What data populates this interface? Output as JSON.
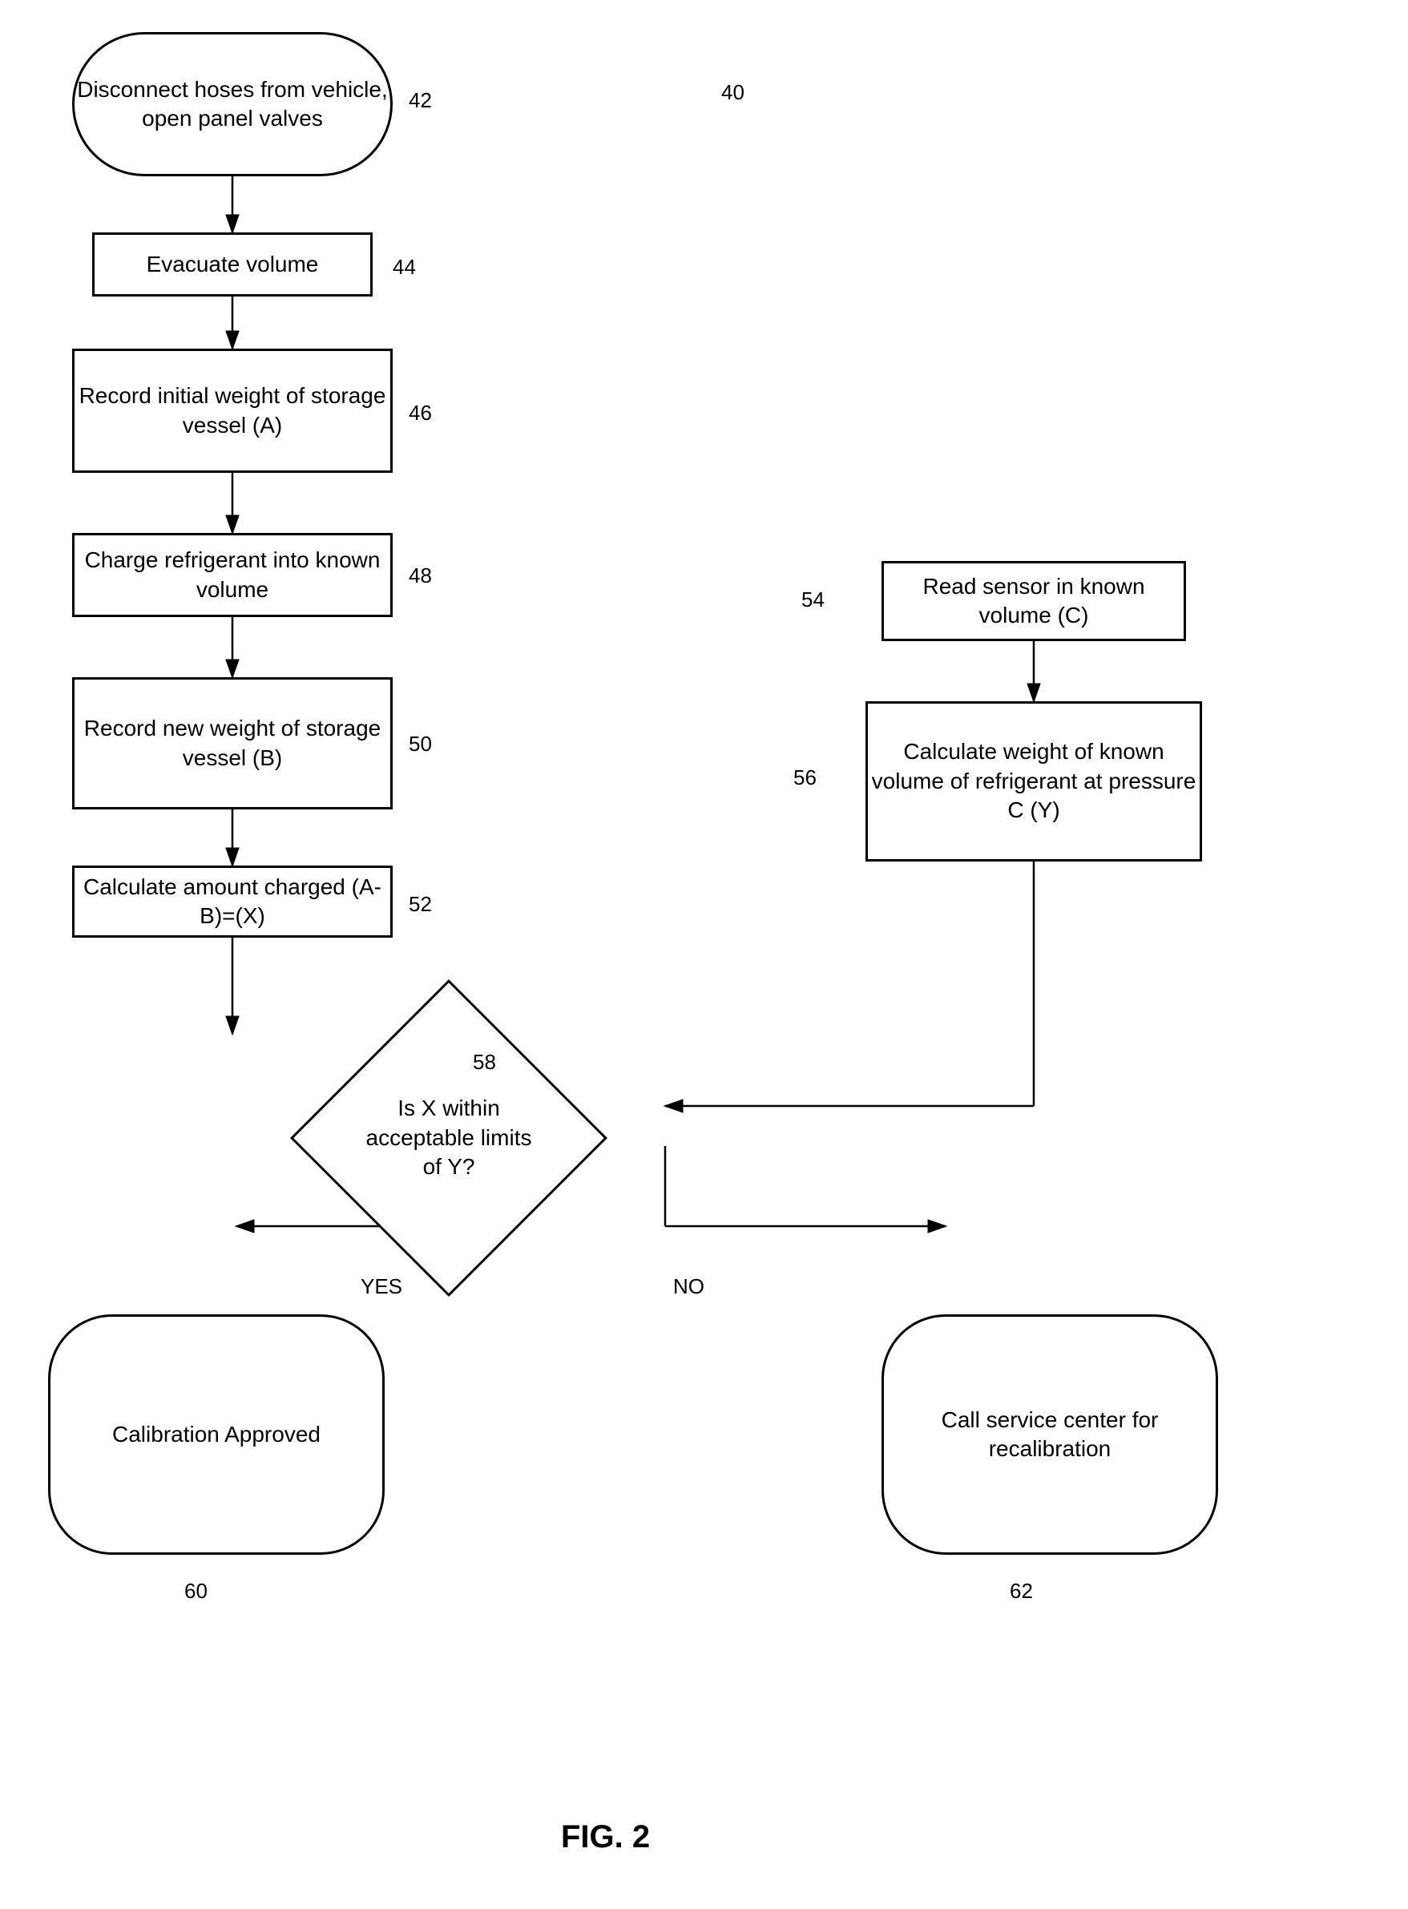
{
  "diagram": {
    "title": "FIG. 2",
    "figure_number": "40",
    "nodes": {
      "step42": {
        "label": "Disconnect\nhoses from\nvehicle, open\npanel valves",
        "id_label": "42"
      },
      "step44": {
        "label": "Evacuate volume",
        "id_label": "44"
      },
      "step46": {
        "label": "Record initial\nweight of storage\nvessel (A)",
        "id_label": "46"
      },
      "step48": {
        "label": "Charge refrigerant\ninto known volume",
        "id_label": "48"
      },
      "step50": {
        "label": "Record new\nweight of storage\nvessel (B)",
        "id_label": "50"
      },
      "step52": {
        "label": "Calculate amount\ncharged (A-B)=(X)",
        "id_label": "52"
      },
      "step54": {
        "label": "Read sensor in\nknown volume (C)",
        "id_label": "54"
      },
      "step56": {
        "label": "Calculate weight of\nknown volume of\nrefrigerant at\npressure C (Y)",
        "id_label": "56"
      },
      "step58": {
        "label": "Is X within\nacceptable\nlimits of Y?",
        "id_label": "58"
      },
      "step60": {
        "label": "Calibration\nApproved",
        "id_label": "60"
      },
      "step62": {
        "label": "Call service\ncenter for\nrecalibration",
        "id_label": "62"
      }
    },
    "labels": {
      "yes": "YES",
      "no": "NO",
      "fig_number": "40"
    }
  }
}
